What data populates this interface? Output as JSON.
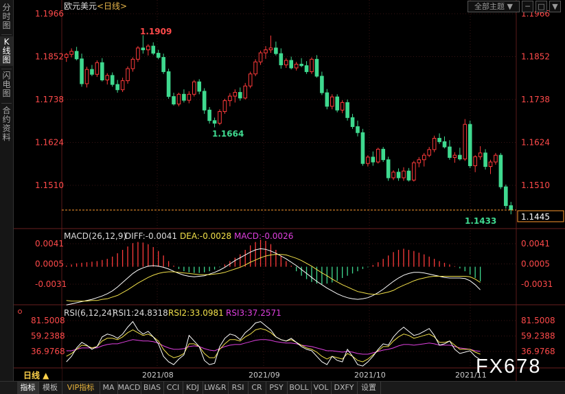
{
  "sidebar": {
    "tabs": [
      "分时图",
      "K线图",
      "闪电图",
      "合约资料"
    ],
    "active": 1
  },
  "header": {
    "symbol": "欧元美元",
    "period": "<日线>",
    "theme_button": "全部主题"
  },
  "price_labels": {
    "high_marker": "1.1909",
    "low_marker_1": "1.1664",
    "low_marker_2": "1.1433",
    "current": "1.1445"
  },
  "macd_header": {
    "title": "MACD(26,12,9)",
    "diff": "DIFF:-0.0041",
    "dea": "DEA:-0.0028",
    "macd": "MACD:-0.0026"
  },
  "rsi_header": {
    "title": "RSI(6,12,24)",
    "rsi1": "RSI1:24.8318",
    "rsi2": "RSI2:33.0981",
    "rsi3": "RSI3:37.2571"
  },
  "colors": {
    "up": "#ff3b3b",
    "down": "#3fd98f",
    "axis_red": "#ff4a4a",
    "grid": "#3a1515",
    "white_line": "#ffffff",
    "yellow_line": "#f2e14a",
    "magenta_line": "#e040e0",
    "accent": "#ff9a2e"
  },
  "chart_data": [
    {
      "type": "candlestick",
      "title": "欧元美元 <日线>",
      "ylim": [
        1.1433,
        1.1966
      ],
      "yticks": [
        "1.1966",
        "1.1852",
        "1.1738",
        "1.1624",
        "1.1510"
      ],
      "xticks": [
        "2021/08",
        "2021/09",
        "2021/10",
        "2021/11"
      ],
      "current_price": 1.1445,
      "candles": [
        [
          1.185,
          1.1862,
          1.1838,
          1.1858
        ],
        [
          1.1858,
          1.1874,
          1.185,
          1.1866
        ],
        [
          1.1866,
          1.1878,
          1.1842,
          1.1846
        ],
        [
          1.1846,
          1.186,
          1.1772,
          1.178
        ],
        [
          1.178,
          1.1825,
          1.177,
          1.1818
        ],
        [
          1.1818,
          1.183,
          1.18,
          1.1805
        ],
        [
          1.1805,
          1.1842,
          1.1798,
          1.1836
        ],
        [
          1.1836,
          1.1848,
          1.1786,
          1.179
        ],
        [
          1.179,
          1.1808,
          1.1778,
          1.1802
        ],
        [
          1.1802,
          1.181,
          1.1772,
          1.1778
        ],
        [
          1.1778,
          1.179,
          1.1756,
          1.1764
        ],
        [
          1.1764,
          1.1796,
          1.1758,
          1.1788
        ],
        [
          1.1788,
          1.1826,
          1.178,
          1.182
        ],
        [
          1.182,
          1.185,
          1.1812,
          1.1845
        ],
        [
          1.1845,
          1.188,
          1.1838,
          1.1875
        ],
        [
          1.1875,
          1.1909,
          1.186,
          1.187
        ],
        [
          1.187,
          1.1885,
          1.1855,
          1.188
        ],
        [
          1.188,
          1.189,
          1.1856,
          1.1861
        ],
        [
          1.1861,
          1.187,
          1.1845,
          1.185
        ],
        [
          1.185,
          1.186,
          1.1806,
          1.1812
        ],
        [
          1.1812,
          1.182,
          1.174,
          1.1746
        ],
        [
          1.1746,
          1.1756,
          1.1722,
          1.1726
        ],
        [
          1.1726,
          1.1756,
          1.172,
          1.1752
        ],
        [
          1.1752,
          1.1765,
          1.173,
          1.1736
        ],
        [
          1.1736,
          1.176,
          1.1728,
          1.1752
        ],
        [
          1.1752,
          1.179,
          1.1746,
          1.1785
        ],
        [
          1.1785,
          1.1792,
          1.1752,
          1.176
        ],
        [
          1.176,
          1.1768,
          1.17,
          1.171
        ],
        [
          1.171,
          1.1718,
          1.1674,
          1.1682
        ],
        [
          1.1682,
          1.169,
          1.1664,
          1.1675
        ],
        [
          1.1675,
          1.1712,
          1.167,
          1.1706
        ],
        [
          1.1706,
          1.174,
          1.17,
          1.1735
        ],
        [
          1.1735,
          1.1755,
          1.172,
          1.1747
        ],
        [
          1.1747,
          1.1765,
          1.173,
          1.1757
        ],
        [
          1.1757,
          1.177,
          1.1735,
          1.1742
        ],
        [
          1.1742,
          1.1782,
          1.1738,
          1.1774
        ],
        [
          1.1774,
          1.1812,
          1.1768,
          1.1806
        ],
        [
          1.1806,
          1.1845,
          1.18,
          1.1838
        ],
        [
          1.1838,
          1.1868,
          1.183,
          1.1862
        ],
        [
          1.1862,
          1.188,
          1.1846,
          1.187
        ],
        [
          1.187,
          1.1908,
          1.1862,
          1.1875
        ],
        [
          1.1875,
          1.1892,
          1.1855,
          1.186
        ],
        [
          1.186,
          1.1874,
          1.182,
          1.183
        ],
        [
          1.183,
          1.1848,
          1.1822,
          1.1842
        ],
        [
          1.1842,
          1.1852,
          1.1818,
          1.1822
        ],
        [
          1.1822,
          1.1838,
          1.1815,
          1.1832
        ],
        [
          1.1832,
          1.1848,
          1.1824,
          1.1828
        ],
        [
          1.1828,
          1.184,
          1.1806,
          1.1812
        ],
        [
          1.1812,
          1.185,
          1.1806,
          1.1845
        ],
        [
          1.1845,
          1.1856,
          1.1796,
          1.18
        ],
        [
          1.18,
          1.1812,
          1.175,
          1.1756
        ],
        [
          1.1756,
          1.1766,
          1.1712,
          1.172
        ],
        [
          1.172,
          1.1752,
          1.1712,
          1.1745
        ],
        [
          1.1745,
          1.1752,
          1.1704,
          1.171
        ],
        [
          1.171,
          1.1736,
          1.1702,
          1.173
        ],
        [
          1.173,
          1.1738,
          1.1682,
          1.169
        ],
        [
          1.169,
          1.17,
          1.166,
          1.1666
        ],
        [
          1.1666,
          1.1682,
          1.164,
          1.165
        ],
        [
          1.165,
          1.166,
          1.1562,
          1.1568
        ],
        [
          1.1568,
          1.159,
          1.156,
          1.1585
        ],
        [
          1.1585,
          1.16,
          1.1562,
          1.1572
        ],
        [
          1.1572,
          1.161,
          1.1568,
          1.1606
        ],
        [
          1.1606,
          1.1612,
          1.1572,
          1.1578
        ],
        [
          1.1578,
          1.1586,
          1.1522,
          1.153
        ],
        [
          1.153,
          1.155,
          1.1524,
          1.1545
        ],
        [
          1.1545,
          1.1555,
          1.1522,
          1.153
        ],
        [
          1.153,
          1.1558,
          1.1522,
          1.1548
        ],
        [
          1.1548,
          1.1556,
          1.152,
          1.1524
        ],
        [
          1.1524,
          1.1575,
          1.152,
          1.157
        ],
        [
          1.157,
          1.1585,
          1.1558,
          1.1578
        ],
        [
          1.1578,
          1.1596,
          1.156,
          1.159
        ],
        [
          1.159,
          1.1612,
          1.1585,
          1.1605
        ],
        [
          1.1605,
          1.1642,
          1.1598,
          1.1635
        ],
        [
          1.1635,
          1.1648,
          1.162,
          1.1626
        ],
        [
          1.1626,
          1.164,
          1.1608,
          1.1612
        ],
        [
          1.1612,
          1.163,
          1.1578,
          1.1584
        ],
        [
          1.1584,
          1.1598,
          1.157,
          1.159
        ],
        [
          1.159,
          1.161,
          1.1576,
          1.158
        ],
        [
          1.158,
          1.1686,
          1.1575,
          1.1672
        ],
        [
          1.1672,
          1.1682,
          1.1556,
          1.1562
        ],
        [
          1.1562,
          1.159,
          1.1545,
          1.1586
        ],
        [
          1.1586,
          1.1614,
          1.1578,
          1.1596
        ],
        [
          1.1596,
          1.1606,
          1.1552,
          1.156
        ],
        [
          1.156,
          1.1578,
          1.154,
          1.1572
        ],
        [
          1.1572,
          1.1596,
          1.1565,
          1.159
        ],
        [
          1.159,
          1.1596,
          1.15,
          1.1506
        ],
        [
          1.1506,
          1.1512,
          1.1448,
          1.1456
        ],
        [
          1.1456,
          1.1466,
          1.1433,
          1.1445
        ]
      ]
    },
    {
      "type": "bar+line",
      "title": "MACD(26,12,9)",
      "yticks": [
        "0.0041",
        "0.0005",
        "-0.0031"
      ],
      "series": [
        {
          "name": "DIFF",
          "current": -0.0041
        },
        {
          "name": "DEA",
          "current": -0.0028
        },
        {
          "name": "MACD",
          "current": -0.0026
        }
      ],
      "macd_bars": [
        0.0002,
        0.0004,
        0.0006,
        0.0007,
        0.0008,
        0.0009,
        0.001,
        0.0012,
        0.0014,
        0.0018,
        0.0024,
        0.003,
        0.0036,
        0.0042,
        0.0044,
        0.0043,
        0.004,
        0.0035,
        0.0028,
        0.002,
        0.001,
        0.0002,
        -0.0004,
        -0.0008,
        -0.001,
        -0.0011,
        -0.0011,
        -0.001,
        -0.0008,
        -0.0005,
        -0.0001,
        0.0004,
        0.001,
        0.0016,
        0.0022,
        0.003,
        0.0038,
        0.0044,
        0.0048,
        0.0046,
        0.004,
        0.003,
        0.002,
        0.001,
        0.0002,
        -0.0008,
        -0.0016,
        -0.0022,
        -0.0027,
        -0.003,
        -0.0031,
        -0.003,
        -0.0028,
        -0.0025,
        -0.002,
        -0.0016,
        -0.0012,
        -0.0008,
        -0.0004,
        -0.0001,
        0.0003,
        0.0008,
        0.0014,
        0.002,
        0.0026,
        0.003,
        0.0032,
        0.003,
        0.0028,
        0.0025,
        0.0022,
        0.0018,
        0.0014,
        0.001,
        0.0007,
        0.0004,
        0.0001,
        -0.0003,
        -0.0008,
        -0.0014,
        -0.002,
        -0.0026
      ],
      "diff_line": [
        -0.0068,
        -0.0066,
        -0.0064,
        -0.0062,
        -0.006,
        -0.0058,
        -0.0055,
        -0.0052,
        -0.0048,
        -0.0043,
        -0.0036,
        -0.0028,
        -0.002,
        -0.0012,
        -0.0006,
        -0.0002,
        0.0001,
        0.0002,
        0.0001,
        -0.0001,
        -0.0004,
        -0.0008,
        -0.0012,
        -0.0015,
        -0.0017,
        -0.0018,
        -0.0017,
        -0.0016,
        -0.0013,
        -0.001,
        -0.0006,
        -0.0001,
        0.0005,
        0.0011,
        0.0016,
        0.0021,
        0.0026,
        0.003,
        0.0032,
        0.0031,
        0.0028,
        0.0024,
        0.0019,
        0.0014,
        0.0008,
        0.0002,
        -0.0005,
        -0.0012,
        -0.0019,
        -0.0026,
        -0.0032,
        -0.0038,
        -0.0043,
        -0.0048,
        -0.0052,
        -0.0055,
        -0.0057,
        -0.0058,
        -0.0057,
        -0.0055,
        -0.0051,
        -0.0046,
        -0.004,
        -0.0033,
        -0.0026,
        -0.002,
        -0.0015,
        -0.0012,
        -0.001,
        -0.001,
        -0.0011,
        -0.0013,
        -0.0015,
        -0.0017,
        -0.0019,
        -0.002,
        -0.002,
        -0.002,
        -0.0021,
        -0.0025,
        -0.0032,
        -0.0041
      ],
      "dea_line": [
        -0.006,
        -0.0061,
        -0.0061,
        -0.0061,
        -0.0061,
        -0.006,
        -0.006,
        -0.0058,
        -0.0057,
        -0.0054,
        -0.0051,
        -0.0046,
        -0.0041,
        -0.0035,
        -0.0029,
        -0.0024,
        -0.0019,
        -0.0015,
        -0.0012,
        -0.001,
        -0.0009,
        -0.0009,
        -0.001,
        -0.0011,
        -0.0012,
        -0.0013,
        -0.0014,
        -0.0014,
        -0.0014,
        -0.0013,
        -0.0012,
        -0.001,
        -0.0007,
        -0.0004,
        -0.0001,
        0.0003,
        0.0008,
        0.0012,
        0.0016,
        0.0019,
        0.0021,
        0.0022,
        0.0022,
        0.0021,
        0.0018,
        0.0015,
        0.0011,
        0.0006,
        0.0001,
        -0.0005,
        -0.0011,
        -0.0016,
        -0.0022,
        -0.0027,
        -0.0032,
        -0.0036,
        -0.004,
        -0.0044,
        -0.0046,
        -0.0048,
        -0.0049,
        -0.0049,
        -0.0047,
        -0.0045,
        -0.0042,
        -0.0037,
        -0.0033,
        -0.0029,
        -0.0025,
        -0.0022,
        -0.002,
        -0.0018,
        -0.0017,
        -0.0017,
        -0.0017,
        -0.0017,
        -0.0017,
        -0.0017,
        -0.0017,
        -0.0018,
        -0.0022,
        -0.0028
      ]
    },
    {
      "type": "line",
      "title": "RSI(6,12,24)",
      "yticks": [
        "81.5008",
        "59.2388",
        "36.9768"
      ],
      "series": [
        {
          "name": "RSI1",
          "current": 24.8318,
          "values": [
            22,
            30,
            42,
            50,
            46,
            40,
            44,
            58,
            62,
            60,
            56,
            62,
            72,
            80,
            68,
            62,
            66,
            58,
            48,
            30,
            22,
            18,
            26,
            32,
            60,
            52,
            44,
            24,
            18,
            20,
            44,
            56,
            62,
            60,
            54,
            64,
            70,
            78,
            80,
            74,
            68,
            58,
            54,
            52,
            56,
            50,
            44,
            40,
            38,
            30,
            22,
            18,
            30,
            24,
            22,
            40,
            30,
            18,
            16,
            22,
            30,
            40,
            48,
            46,
            58,
            66,
            72,
            66,
            60,
            62,
            66,
            70,
            60,
            46,
            48,
            52,
            40,
            34,
            36,
            38,
            30,
            25
          ]
        },
        {
          "name": "RSI2",
          "current": 33.0981,
          "values": [
            30,
            34,
            40,
            46,
            45,
            42,
            44,
            52,
            56,
            56,
            54,
            58,
            64,
            68,
            64,
            60,
            62,
            58,
            52,
            40,
            32,
            28,
            30,
            34,
            48,
            48,
            44,
            34,
            28,
            28,
            40,
            48,
            54,
            54,
            52,
            58,
            62,
            68,
            70,
            68,
            64,
            58,
            54,
            52,
            54,
            50,
            46,
            42,
            40,
            36,
            30,
            26,
            30,
            28,
            26,
            34,
            30,
            24,
            22,
            26,
            32,
            38,
            44,
            44,
            52,
            58,
            62,
            60,
            56,
            58,
            60,
            62,
            58,
            50,
            50,
            52,
            46,
            40,
            40,
            40,
            36,
            33
          ]
        },
        {
          "name": "RSI3",
          "current": 37.2571,
          "values": [
            38,
            38,
            40,
            42,
            42,
            42,
            42,
            45,
            47,
            48,
            48,
            50,
            52,
            54,
            53,
            52,
            52,
            51,
            49,
            45,
            42,
            40,
            40,
            41,
            44,
            45,
            44,
            41,
            39,
            38,
            41,
            44,
            46,
            47,
            47,
            49,
            51,
            53,
            54,
            54,
            53,
            51,
            50,
            49,
            49,
            48,
            46,
            45,
            44,
            42,
            40,
            38,
            38,
            37,
            36,
            37,
            36,
            34,
            33,
            33,
            35,
            37,
            39,
            40,
            42,
            45,
            47,
            47,
            46,
            47,
            48,
            49,
            48,
            46,
            46,
            46,
            44,
            42,
            41,
            40,
            38,
            37
          ]
        }
      ]
    }
  ],
  "bottom_bar": {
    "period_label": "日线 ▲",
    "tabs": [
      "指标",
      "模板",
      "VIP指标",
      "MA",
      "MACD",
      "BIAS",
      "CCI",
      "KDJ",
      "LW&R",
      "RSI",
      "CR",
      "PSY",
      "BOLL",
      "VOL",
      "DXFY",
      "设置"
    ]
  },
  "watermark": "FX678"
}
